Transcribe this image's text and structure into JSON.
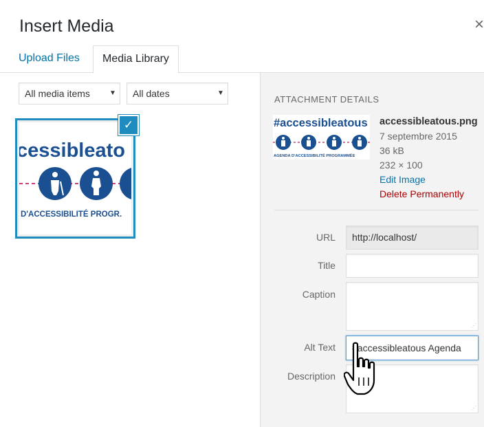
{
  "modal": {
    "title": "Insert Media",
    "close_icon": "×"
  },
  "tabs": [
    {
      "label": "Upload Files",
      "active": false
    },
    {
      "label": "Media Library",
      "active": true
    }
  ],
  "filters": {
    "media_type": "All media items",
    "dates": "All dates"
  },
  "thumbnail": {
    "text_top": "cessibleato",
    "text_bottom": "D'ACCESSIBILITÉ PROGR.",
    "selected": true
  },
  "details": {
    "heading": "ATTACHMENT DETAILS",
    "thumb_title": "#accessibleatous",
    "thumb_subtitle": "AGENDA D'ACCESSIBILITÉ PROGRAMMÉE",
    "filename": "accessibleatous.png",
    "date": "7 septembre 2015",
    "filesize": "36 kB",
    "dimensions": "232 × 100",
    "edit_label": "Edit Image",
    "delete_label": "Delete Permanently"
  },
  "fields": {
    "url_label": "URL",
    "url_value": "http://localhost/",
    "title_label": "Title",
    "title_value": "",
    "caption_label": "Caption",
    "caption_value": "",
    "alt_label": "Alt Text",
    "alt_value": "#accessibleatous Agenda",
    "description_label": "Description",
    "description_value": ""
  },
  "colors": {
    "accent": "#1e8cbe",
    "link": "#0073aa",
    "delete": "#aa0000",
    "logo_blue": "#1a4f91",
    "logo_pink": "#d23a7e"
  },
  "icons": [
    "close-icon",
    "dropdown-arrow-icon",
    "checkmark-icon",
    "hand-pointer-cursor-icon"
  ]
}
